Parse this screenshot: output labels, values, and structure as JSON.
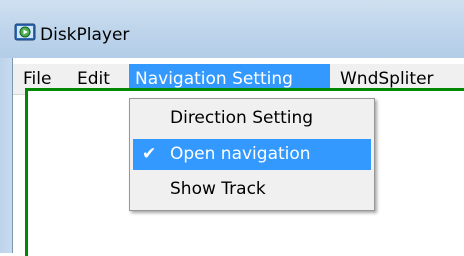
{
  "window": {
    "title": "DiskPlayer",
    "icon": "disk-player-app-icon"
  },
  "menubar": {
    "items": [
      {
        "label": "File"
      },
      {
        "label": "Edit"
      },
      {
        "label": "Navigation Setting"
      },
      {
        "label": "WndSpliter"
      }
    ],
    "active_item": "Navigation Setting"
  },
  "dropdown": {
    "items": [
      {
        "label": "Direction Setting",
        "checked": false
      },
      {
        "label": "Open navigation",
        "checked": true
      },
      {
        "label": "Show Track",
        "checked": false
      }
    ],
    "check_glyph": "✔"
  },
  "colors": {
    "highlight": "#3399ff",
    "client_border": "#008800",
    "titlebar": "#bcd3ea",
    "menu_bg": "#f0f0f0"
  }
}
